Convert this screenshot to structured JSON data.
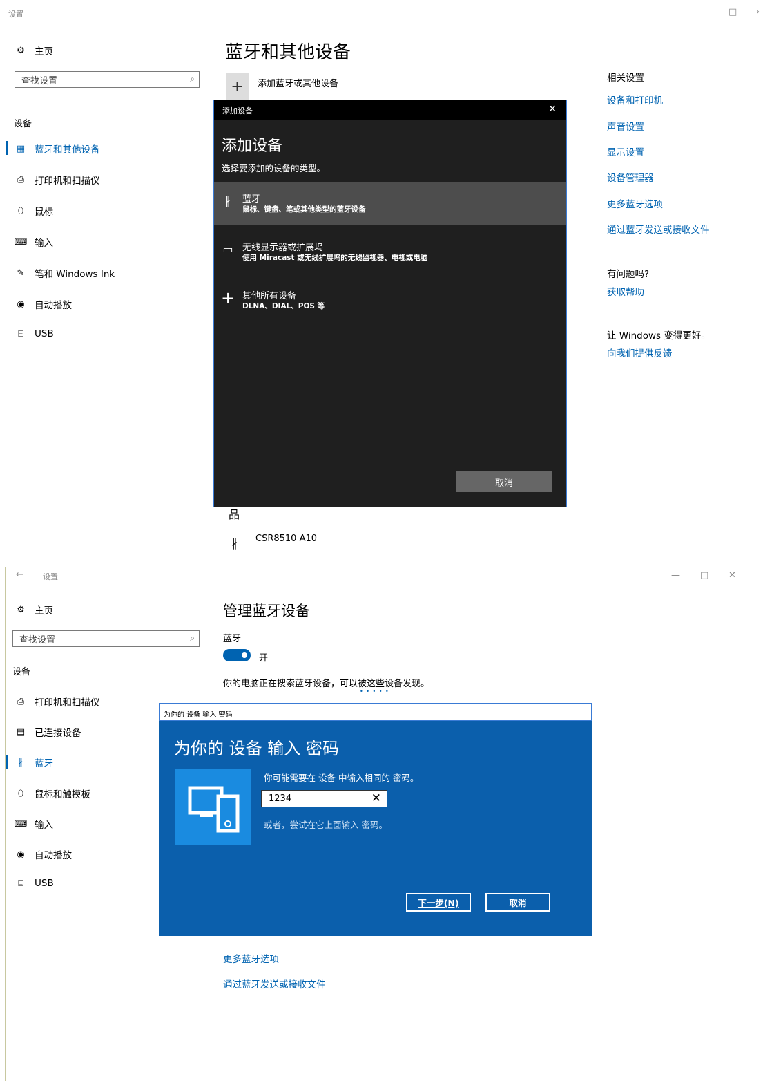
{
  "top": {
    "window_title": "设置",
    "controls": {
      "minimize": "—",
      "maximize": "□",
      "close": "✕"
    },
    "home_label": "主页",
    "search_placeholder": "查找设置",
    "section_label": "设备",
    "nav": [
      {
        "label": "蓝牙和其他设备",
        "icon": "devices-icon",
        "glyph": "▦"
      },
      {
        "label": "打印机和扫描仪",
        "icon": "printer-icon",
        "glyph": "⎙"
      },
      {
        "label": "鼠标",
        "icon": "mouse-icon",
        "glyph": "⬯"
      },
      {
        "label": "输入",
        "icon": "keyboard-icon",
        "glyph": "⌨"
      },
      {
        "label": "笔和 Windows Ink",
        "icon": "pen-icon",
        "glyph": "✎"
      },
      {
        "label": "自动播放",
        "icon": "autoplay-icon",
        "glyph": "◉"
      },
      {
        "label": "USB",
        "icon": "usb-icon",
        "glyph": "⌸"
      }
    ],
    "page_title": "蓝牙和其他设备",
    "add_device_label": "添加蓝牙或其他设备",
    "related_title": "相关设置",
    "related_links": [
      "设备和打印机",
      "声音设置",
      "显示设置",
      "设备管理器",
      "更多蓝牙选项",
      "通过蓝牙发送或接收文件"
    ],
    "question_title": "有问题吗?",
    "help_link": "获取帮助",
    "improve_title": "让 Windows 变得更好。",
    "feedback_link": "向我们提供反馈",
    "device_name": "CSR8510 A10"
  },
  "add_dialog": {
    "bar_title": "添加设备",
    "heading": "添加设备",
    "subtitle": "选择要添加的设备的类型。",
    "options": [
      {
        "title": "蓝牙",
        "desc": "鼠标、键盘、笔或其他类型的蓝牙设备",
        "icon": "bluetooth-icon"
      },
      {
        "title": "无线显示器或扩展坞",
        "desc": "使用 Miracast 或无线扩展坞的无线监视器、电视或电脑",
        "icon": "monitor-icon"
      },
      {
        "title": "其他所有设备",
        "desc": "DLNA、DIAL、POS 等",
        "icon": "plus-icon"
      }
    ],
    "cancel": "取消"
  },
  "bottom": {
    "back": "←",
    "window_title": "设置",
    "home_label": "主页",
    "search_placeholder": "查找设置",
    "section_label": "设备",
    "nav": [
      {
        "label": "打印机和扫描仪",
        "icon": "printer-icon",
        "glyph": "⎙"
      },
      {
        "label": "已连接设备",
        "icon": "connected-devices-icon",
        "glyph": "▤"
      },
      {
        "label": "蓝牙",
        "icon": "bluetooth-icon",
        "glyph": "∦"
      },
      {
        "label": "鼠标和触摸板",
        "icon": "mouse-icon",
        "glyph": "⬯"
      },
      {
        "label": "输入",
        "icon": "keyboard-icon",
        "glyph": "⌨"
      },
      {
        "label": "自动播放",
        "icon": "autoplay-icon",
        "glyph": "◉"
      },
      {
        "label": "USB",
        "icon": "usb-icon",
        "glyph": "⌸"
      }
    ],
    "page_title": "管理蓝牙设备",
    "bt_label": "蓝牙",
    "toggle_label": "开",
    "searching_text": "你的电脑正在搜索蓝牙设备，可以被这些设备发现。",
    "progress_dots": "• • • •   •",
    "links": [
      "更多蓝牙选项",
      "通过蓝牙发送或接收文件"
    ]
  },
  "pin_dialog": {
    "bar_title": "为你的 设备 输入 密码",
    "heading": "为你的 设备 输入 密码",
    "instruction": "你可能需要在 设备 中输入相同的 密码。",
    "pin_value": "1234",
    "alt_text": "或者，尝试在它上面输入 密码。",
    "next": "下一步(N)",
    "cancel": "取消"
  }
}
